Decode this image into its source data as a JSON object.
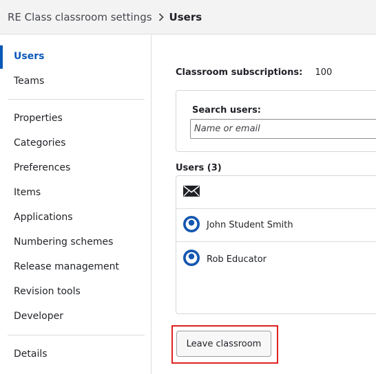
{
  "header": {
    "breadcrumb_root": "RE Class classroom settings",
    "breadcrumb_current": "Users"
  },
  "sidebar": {
    "items": [
      {
        "label": "Users",
        "active": true
      },
      {
        "label": "Teams"
      },
      {
        "label": "Properties"
      },
      {
        "label": "Categories"
      },
      {
        "label": "Preferences"
      },
      {
        "label": "Items"
      },
      {
        "label": "Applications"
      },
      {
        "label": "Numbering schemes"
      },
      {
        "label": "Release management"
      },
      {
        "label": "Revision tools"
      },
      {
        "label": "Developer"
      },
      {
        "label": "Details"
      }
    ]
  },
  "main": {
    "subscriptions_label": "Classroom subscriptions:",
    "subscriptions_value": "100",
    "search": {
      "label": "Search users:",
      "placeholder": "Name or email"
    },
    "users_heading": "Users (3)",
    "users": [
      {
        "name": "John Student Smith",
        "icon": "user-avatar-icon"
      },
      {
        "name": "Rob Educator",
        "icon": "user-avatar-icon"
      }
    ],
    "invite_icon": "envelope-icon",
    "leave_button": "Leave classroom"
  },
  "colors": {
    "accent": "#0a58b8",
    "highlight": "#e02020"
  }
}
